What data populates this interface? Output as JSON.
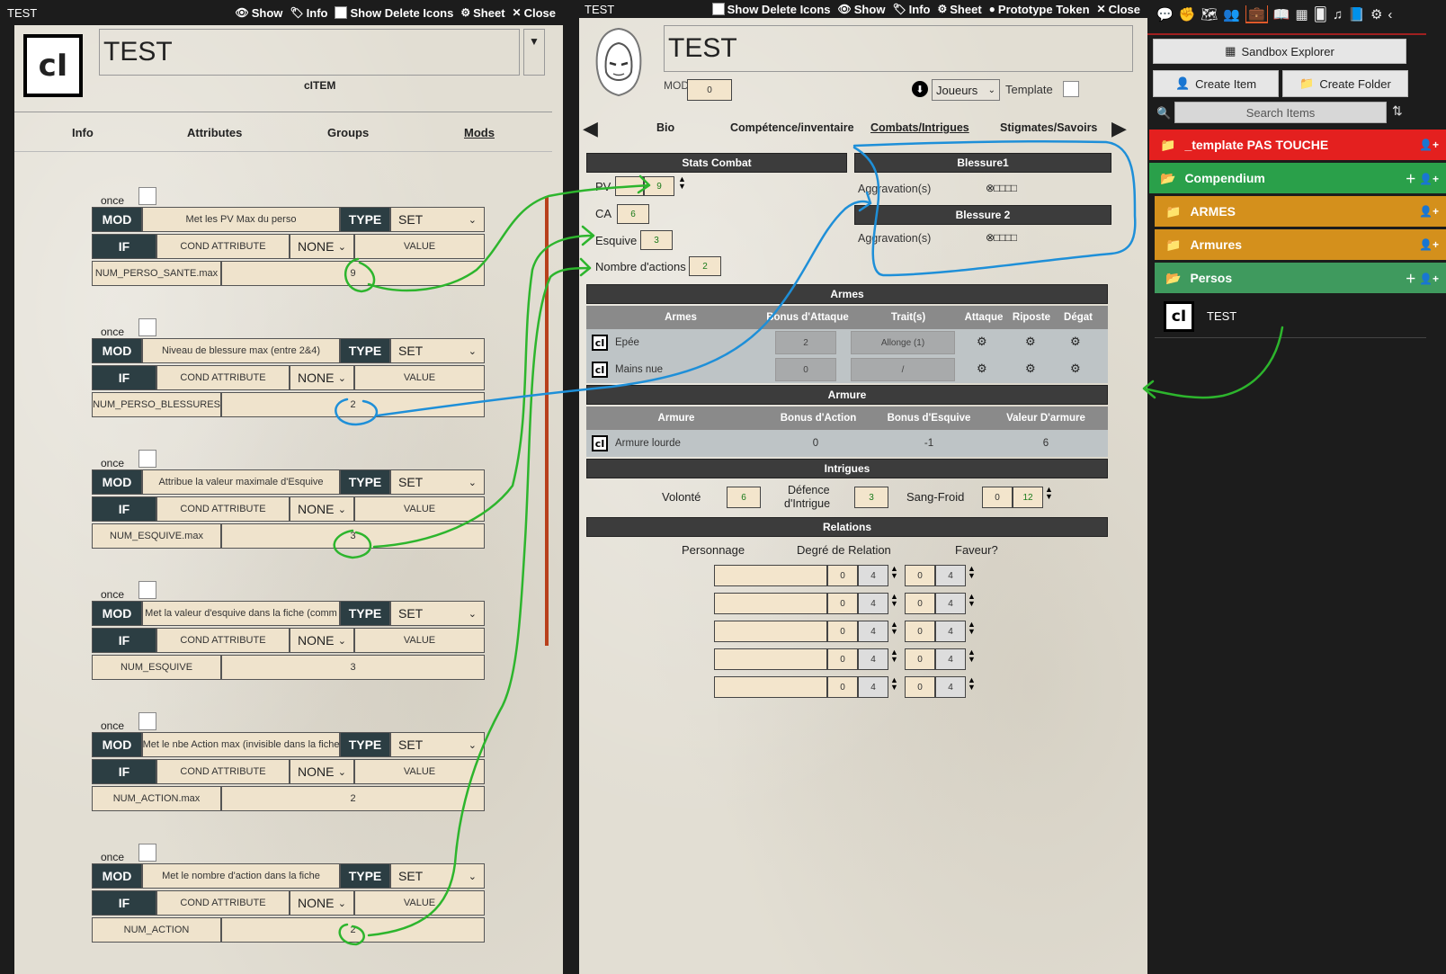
{
  "left": {
    "title_bar": {
      "name": "TEST",
      "show": "Show",
      "info": "Info",
      "show_delete_icons": "Show Delete Icons",
      "sheet": "Sheet",
      "close": "Close"
    },
    "item_name": "TEST",
    "item_type": "cITEM",
    "logo": "cI",
    "tabs": [
      "Info",
      "Attributes",
      "Groups",
      "Mods"
    ],
    "mods": [
      {
        "once": "once",
        "mod": "MOD",
        "description": "Met les PV Max du perso",
        "type_label": "TYPE",
        "type": "SET",
        "if": "IF",
        "cond": "COND ATTRIBUTE",
        "cond_op": "NONE",
        "value_ph": "VALUE",
        "attribute": "NUM_PERSO_SANTE.max",
        "value": "9"
      },
      {
        "once": "once",
        "mod": "MOD",
        "description": "Niveau de blessure max (entre 2&4)",
        "type_label": "TYPE",
        "type": "SET",
        "if": "IF",
        "cond": "COND ATTRIBUTE",
        "cond_op": "NONE",
        "value_ph": "VALUE",
        "attribute": "NUM_PERSO_BLESSURES",
        "value": "2"
      },
      {
        "once": "once",
        "mod": "MOD",
        "description": "Attribue la valeur maximale d'Esquive",
        "type_label": "TYPE",
        "type": "SET",
        "if": "IF",
        "cond": "COND ATTRIBUTE",
        "cond_op": "NONE",
        "value_ph": "VALUE",
        "attribute": "NUM_ESQUIVE.max",
        "value": "3"
      },
      {
        "once": "once",
        "mod": "MOD",
        "description": "Met la valeur d'esquive dans la fiche (comm",
        "type_label": "TYPE",
        "type": "SET",
        "if": "IF",
        "cond": "COND ATTRIBUTE",
        "cond_op": "NONE",
        "value_ph": "VALUE",
        "attribute": "NUM_ESQUIVE",
        "value": "3"
      },
      {
        "once": "once",
        "mod": "MOD",
        "description": "Met le nbe Action max (invisible dans la fiche",
        "type_label": "TYPE",
        "type": "SET",
        "if": "IF",
        "cond": "COND ATTRIBUTE",
        "cond_op": "NONE",
        "value_ph": "VALUE",
        "attribute": "NUM_ACTION.max",
        "value": "2"
      },
      {
        "once": "once",
        "mod": "MOD",
        "description": "Met le nombre d'action dans la fiche",
        "type_label": "TYPE",
        "type": "SET",
        "if": "IF",
        "cond": "COND ATTRIBUTE",
        "cond_op": "NONE",
        "value_ph": "VALUE",
        "attribute": "NUM_ACTION",
        "value": "2"
      }
    ]
  },
  "middle": {
    "title_bar": {
      "name": "TEST",
      "show_delete_icons": "Show Delete Icons",
      "show": "Show",
      "info": "Info",
      "sheet": "Sheet",
      "prototype_token": "Prototype Token",
      "close": "Close"
    },
    "actor_name": "TEST",
    "mod_label": "MOD",
    "mod_value": "0",
    "players_select": "Joueurs",
    "template_label": "Template",
    "tabs": [
      "Bio",
      "Compétence/inventaire",
      "Combats/Intrigues",
      "Stigmates/Savoirs"
    ],
    "stats_combat": {
      "header": "Stats Combat",
      "pv_label": "PV",
      "pv_value": "9",
      "ca_label": "CA",
      "ca_value": "6",
      "esquive_label": "Esquive",
      "esquive_value": "3",
      "actions_label": "Nombre d'actions",
      "actions_value": "2"
    },
    "blessure1": {
      "header": "Blessure1",
      "label": "Aggravation(s)",
      "pips": "⊗□□□□"
    },
    "blessure2": {
      "header": "Blessure 2",
      "label": "Aggravation(s)",
      "pips": "⊗□□□□"
    },
    "armes": {
      "header": "Armes",
      "columns": [
        "Armes",
        "Bonus d'Attaque",
        "Trait(s)",
        "Attaque",
        "Riposte",
        "Dégat"
      ],
      "rows": [
        {
          "name": "Epée",
          "bonus": "2",
          "traits": "Allonge (1)"
        },
        {
          "name": "Mains nue",
          "bonus": "0",
          "traits": "/"
        }
      ]
    },
    "armure": {
      "header": "Armure",
      "columns": [
        "Armure",
        "Bonus d'Action",
        "Bonus d'Esquive",
        "Valeur D'armure"
      ],
      "rows": [
        {
          "name": "Armure lourde",
          "bonus_action": "0",
          "bonus_esquive": "-1",
          "valeur": "6"
        }
      ]
    },
    "intrigues": {
      "header": "Intrigues",
      "volonte_label": "Volonté",
      "volonte": "6",
      "defence_label_1": "Défence",
      "defence_label_2": "d'Intrigue",
      "defence": "3",
      "sangfroid_label": "Sang-Froid",
      "sangfroid": "0",
      "sangfroid_max": "12"
    },
    "relations": {
      "header": "Relations",
      "columns": [
        "Personnage",
        "Degré de Relation",
        "Faveur?"
      ],
      "rows": [
        {
          "deg": "0",
          "deg_max": "4",
          "fav": "0",
          "fav_max": "4"
        },
        {
          "deg": "0",
          "deg_max": "4",
          "fav": "0",
          "fav_max": "4"
        },
        {
          "deg": "0",
          "deg_max": "4",
          "fav": "0",
          "fav_max": "4"
        },
        {
          "deg": "0",
          "deg_max": "4",
          "fav": "0",
          "fav_max": "4"
        },
        {
          "deg": "0",
          "deg_max": "4",
          "fav": "0",
          "fav_max": "4"
        }
      ]
    }
  },
  "right": {
    "sandbox_explorer": "Sandbox Explorer",
    "create_item": "Create Item",
    "create_folder": "Create Folder",
    "search_placeholder": "Search Items",
    "folders": [
      {
        "name": "_template PAS TOUCHE",
        "color": "#e4201f"
      },
      {
        "name": "Compendium",
        "color": "#2aa04a"
      },
      {
        "name": "ARMES",
        "color": "#d4901c"
      },
      {
        "name": "Armures",
        "color": "#d4901c"
      },
      {
        "name": "Persos",
        "color": "#3f9a5e"
      }
    ],
    "item": {
      "name": "TEST",
      "logo": "cI"
    }
  }
}
